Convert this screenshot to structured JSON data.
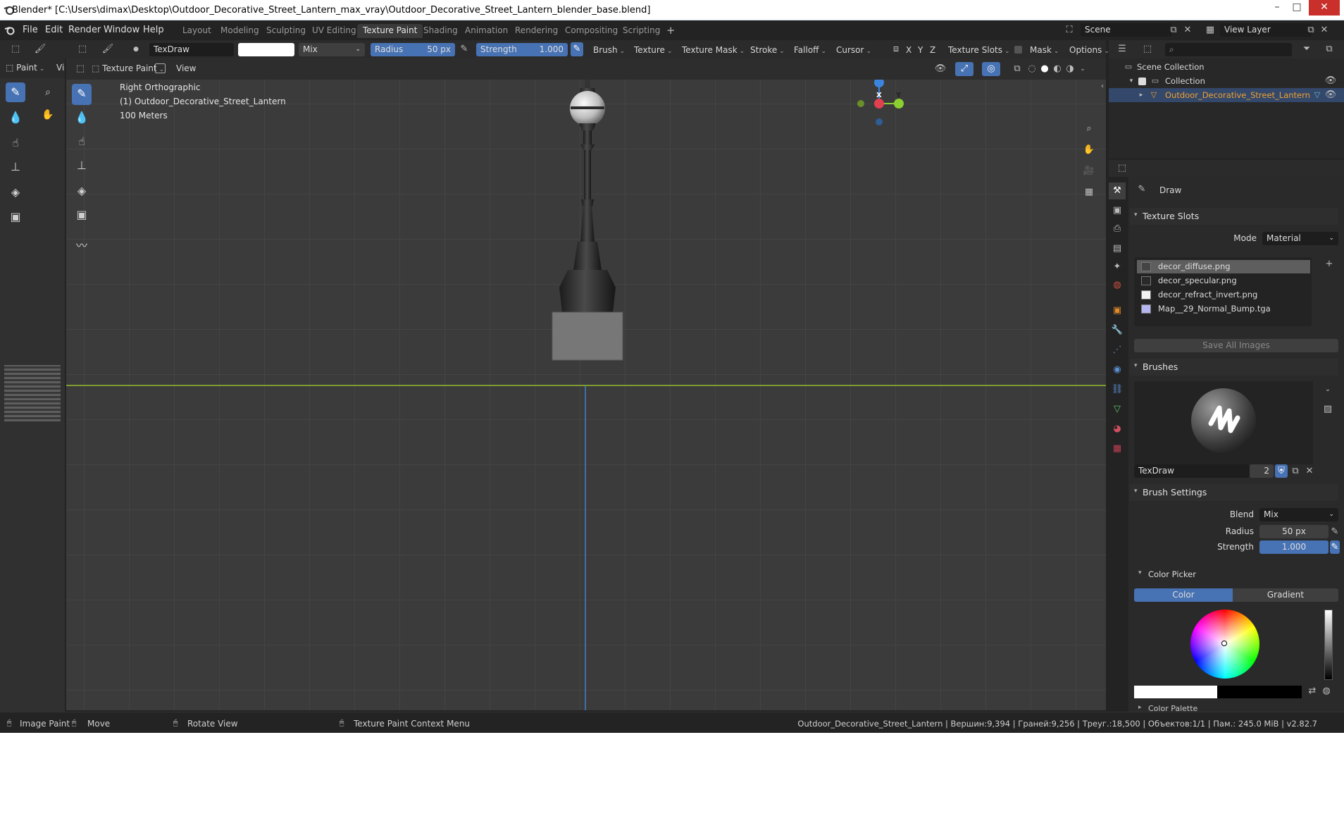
{
  "window": {
    "title": "Blender* [C:\\Users\\dimax\\Desktop\\Outdoor_Decorative_Street_Lantern_max_vray\\Outdoor_Decorative_Street_Lantern_blender_base.blend]",
    "min_label": "–",
    "max_label": "□",
    "close_label": "✕"
  },
  "menu": {
    "file": "File",
    "edit": "Edit",
    "render": "Render",
    "window": "Window",
    "help": "Help"
  },
  "workspaces": [
    "Layout",
    "Modeling",
    "Sculpting",
    "UV Editing",
    "Texture Paint",
    "Shading",
    "Animation",
    "Rendering",
    "Compositing",
    "Scripting"
  ],
  "active_workspace": "Texture Paint",
  "add_workspace": "+",
  "scene": {
    "name": "Scene",
    "view_layer": "View Layer"
  },
  "tool_header": {
    "brush_name": "TexDraw",
    "blend": "Mix",
    "radius_label": "Radius",
    "radius_value": "50 px",
    "strength_label": "Strength",
    "strength_value": "1.000",
    "brush_menu": "Brush",
    "texture_menu": "Texture",
    "texture_mask_menu": "Texture Mask",
    "stroke_menu": "Stroke",
    "falloff_menu": "Falloff",
    "cursor_menu": "Cursor",
    "axes": [
      "X",
      "Y",
      "Z"
    ],
    "texture_slots_menu": "Texture Slots",
    "mask_menu": "Mask",
    "options_menu": "Options"
  },
  "editor_header": {
    "left_mode": "Paint",
    "left_extra": "Vi",
    "mode": "Texture Paint",
    "view_menu": "View"
  },
  "viewport": {
    "view_name": "Right Orthographic",
    "object_label": "(1) Outdoor_Decorative_Street_Lantern",
    "scale": "100 Meters",
    "gizmo": {
      "z": "Z",
      "x": "X",
      "y": "Y"
    }
  },
  "outliner": {
    "search_placeholder": "",
    "scene_collection": "Scene Collection",
    "collection": "Collection",
    "object": "Outdoor_Decorative_Street_Lantern"
  },
  "properties": {
    "tool_name": "Draw",
    "texture_slots_panel": "Texture Slots",
    "mode_label": "Mode",
    "mode_value": "Material",
    "slots": [
      {
        "name": "decor_diffuse.png",
        "selected": true,
        "swatch": "#444444"
      },
      {
        "name": "decor_specular.png",
        "selected": false,
        "swatch": "#2a2a2a"
      },
      {
        "name": "decor_refract_invert.png",
        "selected": false,
        "swatch": "#f2f2f2"
      },
      {
        "name": "Map__29_Normal_Bump.tga",
        "selected": false,
        "swatch": "#b4b4ee"
      }
    ],
    "save_all_images": "Save All Images",
    "brushes_panel": "Brushes",
    "brush_name": "TexDraw",
    "brush_users": "2",
    "brush_settings_panel": "Brush Settings",
    "blend_label": "Blend",
    "blend_value": "Mix",
    "radius_label": "Radius",
    "radius_value": "50 px",
    "strength_label": "Strength",
    "strength_value": "1.000",
    "color_picker_panel": "Color Picker",
    "color_tab": "Color",
    "gradient_tab": "Gradient",
    "color_palette_panel": "Color Palette"
  },
  "statusbar": {
    "image_paint": "Image Paint",
    "move": "Move",
    "rotate_view": "Rotate View",
    "context_menu": "Texture Paint Context Menu",
    "stats": "Outdoor_Decorative_Street_Lantern | Вершин:9,394 | Граней:9,256 | Треуг.:18,500 | Объектов:1/1 | Пам.: 245.0 MiB | v2.82.7"
  },
  "colors": {
    "accent": "#4772b3",
    "selected_object": "#f0a030",
    "axis_x": "#e04050",
    "axis_y": "#8ccf30",
    "axis_z": "#3b85e0"
  }
}
